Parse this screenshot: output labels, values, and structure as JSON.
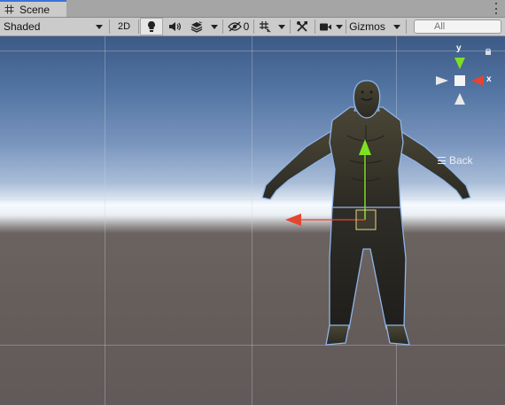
{
  "tab": {
    "label": "Scene",
    "icon": "grid-icon"
  },
  "toolbar": {
    "shading_mode": "Shaded",
    "mode_2d": "2D",
    "hidden_count": "0",
    "gizmos_label": "Gizmos",
    "search_placeholder": "All"
  },
  "orientation_gizmo": {
    "y_label": "y",
    "x_label": "x",
    "view_label": "Back"
  },
  "colors": {
    "accent": "#3a72d8",
    "axis_y": "#7ee023",
    "axis_x": "#e3452f"
  }
}
